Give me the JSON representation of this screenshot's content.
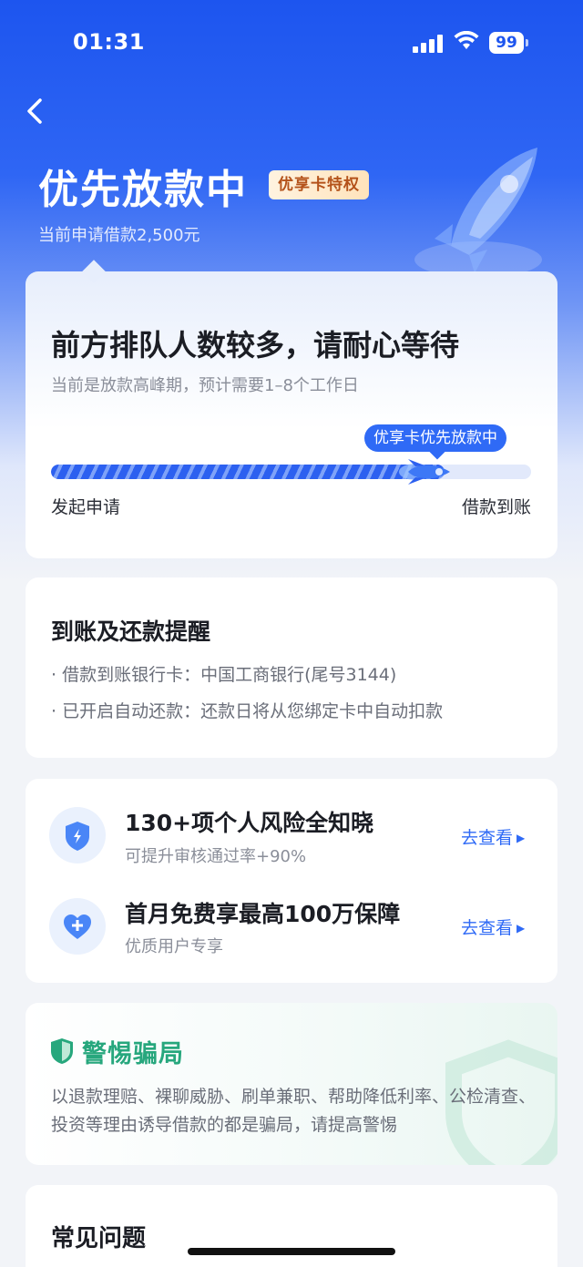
{
  "status_bar": {
    "time": "01:31",
    "battery": "99"
  },
  "header": {
    "title": "优先放款中",
    "badge": "优享卡特权",
    "subtitle": "当前申请借款2,500元"
  },
  "status_card": {
    "title": "前方排队人数较多，请耐心等待",
    "subtitle": "当前是放款高峰期，预计需要1–8个工作日",
    "progress_tip": "优享卡优先放款中",
    "progress": 0.82,
    "start_label": "发起申请",
    "end_label": "借款到账"
  },
  "reminder": {
    "title": "到账及还款提醒",
    "lines": [
      "· 借款到账银行卡：中国工商银行(尾号3144)",
      "· 已开启自动还款：还款日将从您绑定卡中自动扣款"
    ]
  },
  "benefits": [
    {
      "icon": "shield-lightning-icon",
      "title": "130+项个人风险全知晓",
      "subtitle": "可提升审核通过率+90%",
      "link": "去查看"
    },
    {
      "icon": "heart-plus-icon",
      "title": "首月免费享最高100万保障",
      "subtitle": "优质用户专享",
      "link": "去查看"
    }
  ],
  "warning": {
    "title": "警惕骗局",
    "text": "以退款理赔、裸聊威胁、刷单兼职、帮助降低利率、公检清查、投资等理由诱导借款的都是骗局，请提高警惕"
  },
  "faq": {
    "title": "常见问题"
  },
  "colors": {
    "primary": "#2f6af6",
    "warning_green": "#27a77d",
    "badge_text": "#b4521a"
  }
}
